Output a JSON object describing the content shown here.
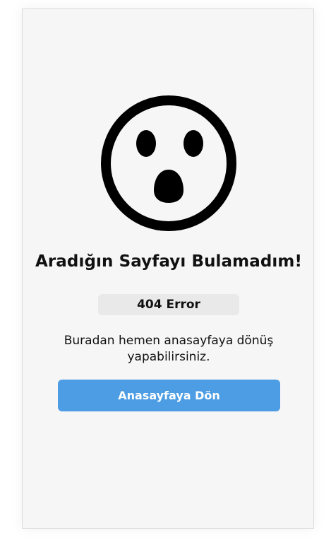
{
  "illustration": {
    "icon": "surprised-face-icon",
    "color": "#000000"
  },
  "error": {
    "title": "Aradığın Sayfayı Bulamadım!",
    "code_label": "404 Error",
    "description": "Buradan hemen anasayfaya dönüş yapabilirsiniz."
  },
  "actions": {
    "home_button_label": "Anasayfaya Dön",
    "home_button_color": "#4d9de4"
  }
}
